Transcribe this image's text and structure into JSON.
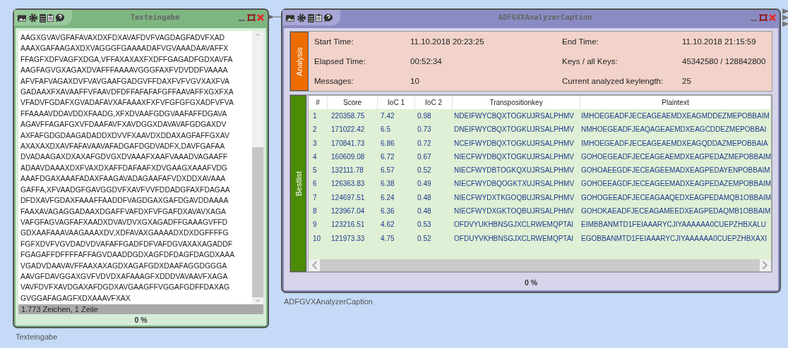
{
  "text_input": {
    "title": "Texteingabe",
    "lines": [
      "AAGXGVAVGFAFAVAXDXFDXAVAFDVFVAGDAGFADVFXAD",
      "AAAXGAFAAGAXDXVAGGGFGAAAADAFVGVAAADAAVAFFX",
      "FFAGFXDFVAGFXDGA,VFFAXAXAXFXDFFGAGADFGDXAVFA",
      "AAGFAGVGXAGAXDVAFFFAAAAVGGGFAXFVDVDDFVAAAA",
      "AFVFAFVAGAXDVFVAVGAAFGADGVFFDAXFVFVGVXAXFVA",
      "GADAAXFXAVAAFFVFAAVDFDFFAFAFAFGFFAAVAFFXGXFXA",
      "VFADVFGDAFXGVADAFAVXAFAAAXFXFVFGFGFGXADFVFVA",
      "FFAAAAVDDAVDDXFAADG,XFXDVAAFGDGVAAFAFFDGAVA",
      "AGAVFFAGAFGXVFDAAFAVFXAVDGGXDAVAVAFGDGAXDV",
      "AXFAFGDGDAAGADADDXDVVFXAAVDXDDAXAGFAFFGXAV",
      "AXAXAXDXAVFAFAVAAVAFADGAFDGDVADFX,DAVFGAFAA",
      "DVADAAGAXDXAXAFGDVGXDVAAAFXAAFVAAADVAGAAFF",
      "ADAAVDAAAXDXFVAXDXAFFDAFAAFXDVGAAGXAAAFVDG",
      "AAAFDGAXAAAFADAXFAAGAVADAGAAFAFVDXDDXAVAAA",
      "GAFFA,XFVAADGFGAVGGDVFXAVFVVFDDADGFAXFDAGAA",
      "DFDXAVFGDAXFAAAFFAADDFVAGDGAXGAFDGAVDDAAAA",
      "FAAXAVAGAGGADAAXDGAFFVAFDXFVFGAFDXAVAVXAGA",
      "VAFGFAGVAGFAFXAADXDVAVDVXGXAGADFFGAAAGVFFD",
      "GDXAAFAAAVAAGAAAXDV,XDFAVAXGAAAADXDXDGFFFFG",
      "FGFXDVFVGVDADVDVAFAFFGADFDFVAFDGVAXAXAGADDF",
      "FGAGAFFDFFFFAFFAGVDAADDGDXAGFDFDAGFDAGDXAAA",
      "VGADVDAAVAVFFAAXAXAGDXAGAFGDXDAAFAGGDGGGA",
      "AAVGFDAVGGAXGVFVDVDXAFAAAGFXDDDVAVAAVFXAGA",
      "VAVFDVFXAVDGAXAFDGDXAVGAAGFFVGGAFGDFFDAXAG",
      "GVGGAFAGAGFXDXAAAVFXAX"
    ],
    "status": "1.773 Zeichen,  1 Zeile",
    "progress": "0 %",
    "caption": "Texteingabe"
  },
  "analyzer": {
    "title": "ADFGVXAnalyzerCaption",
    "analysis": {
      "tab": "Analysis",
      "fields": [
        {
          "label": "Start Time:",
          "value": "11.10.2018 20:23:25"
        },
        {
          "label": "End Time:",
          "value": "11.10.2018 21:15:59"
        },
        {
          "label": "Elapsed Time:",
          "value": "00:52:34"
        },
        {
          "label": "Keys / all Keys:",
          "value": "45342580 / 128842800"
        },
        {
          "label": "Messages:",
          "value": "10"
        },
        {
          "label": "Current analyzed keylength:",
          "value": "25"
        }
      ]
    },
    "bestlist": {
      "tab": "Bestlist",
      "columns": [
        "#",
        "Score",
        "IoC 1",
        "IoC 2",
        "Transpositionkey",
        "Plaintext"
      ],
      "rows": [
        [
          "1",
          "220358.75",
          "7.42",
          "0.98",
          "NDEIFWYCBQXTOGKUJRSALPHMV",
          "IMHOEGEADFJECEAGEAEMDXEAGMDDEZMEPOBBAIM"
        ],
        [
          "2",
          "171022.42",
          "6.5",
          "0.73",
          "DNEIFWYCBQXTOGKUJRSALPHMV",
          "NMHOEGEADFJEAQAGEAEMDXEAGCDDEZMEPOBBAI"
        ],
        [
          "3",
          "170841.73",
          "6.86",
          "0.72",
          "NCEIFWYDBQXTOGKUJRSALPHMV",
          "IMHOEGEADFJECEAGEAEMDXEAGQDDAZMEPOBBAIA"
        ],
        [
          "4",
          "160609.08",
          "6.72",
          "0.67",
          "NIECFWYDBQXTOGKUJRSALPHMV",
          "GOHOEGEADFJECEAGEAEMDXEAGPEDAZMEPOBBAIM"
        ],
        [
          "5",
          "132111.78",
          "6.57",
          "0.52",
          "NIECFWYDBTOGKQXUJRSALPHMV",
          "GOHOAEEGDFJECEAGEEMADXEAGPEDAYENPOBBAIM"
        ],
        [
          "6",
          "126363.83",
          "6.38",
          "0.49",
          "NIECFWYDBQOGKTXUJRSALPHMV",
          "GOHOEEAGDFJECEAGEEMADXEAGPEDAZEMPOBBAIM"
        ],
        [
          "7",
          "124697.51",
          "6.24",
          "0.48",
          "NIECFWYDXTKGOQBUJRSALPHMV",
          "GOHOGEEADFJECEAGAAQEDXEAGPEDAMQB1OBBAIM"
        ],
        [
          "8",
          "123967.04",
          "6.36",
          "0.48",
          "NIECFWYDXGKTOQBUJRSALPHMV",
          "GOHOKAEADFJECEAGAMEEDXEAGPEDAQMB1OBBAIM"
        ],
        [
          "9",
          "123216.51",
          "4.62",
          "0.53",
          "OFDVYUKHBNSGJXCLRWEMQPTAI",
          "EIMBBANMTD1FEIAAARYCJIYAAAAAA0CUEPZHBXALU"
        ],
        [
          "10",
          "121973.33",
          "4.75",
          "0.52",
          "OFDUYVKHBNSGJXCLRWEMQPTAI",
          "EGOBBANMTD1FEIAAARYCJIYAAAAAA0CUEPZHBXAXI"
        ]
      ]
    },
    "progress": "0 %",
    "caption": "ADFGVXAnalyzerCaption"
  }
}
